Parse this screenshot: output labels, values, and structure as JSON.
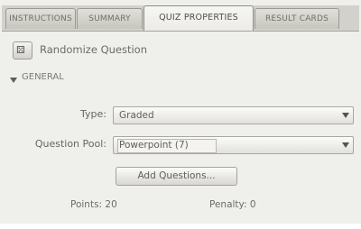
{
  "tabs": [
    {
      "label": "INSTRUCTIONS",
      "active": false
    },
    {
      "label": "SUMMARY",
      "active": false
    },
    {
      "label": "QUIZ PROPERTIES",
      "active": true
    },
    {
      "label": "RESULT CARDS",
      "active": false
    }
  ],
  "randomize": {
    "label": "Randomize Question",
    "icon": "dice-icon"
  },
  "section": {
    "label": "GENERAL",
    "expanded": true
  },
  "form": {
    "type": {
      "label": "Type:",
      "value": "Graded"
    },
    "question_pool": {
      "label": "Question Pool:",
      "value": "Powerpoint (7)"
    },
    "add_questions_label": "Add Questions..."
  },
  "footer": {
    "points": "Points: 20",
    "penalty": "Penalty: 0"
  }
}
